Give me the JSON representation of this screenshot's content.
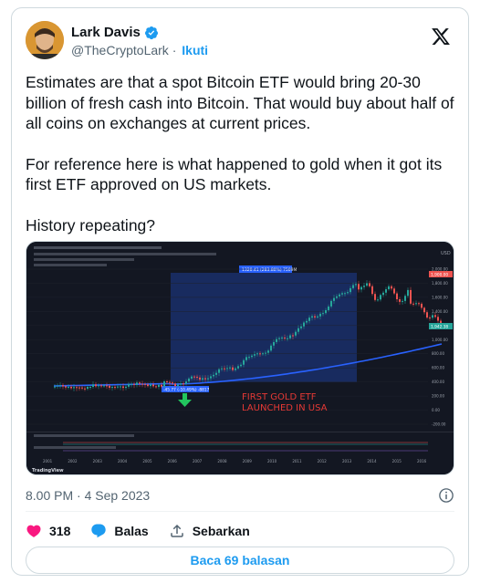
{
  "author": {
    "name": "Lark Davis",
    "handle": "@TheCryptoLark",
    "follow_label": "Ikuti"
  },
  "tweet": {
    "paragraphs": [
      "Estimates are that a spot Bitcoin ETF would bring 20-30 billion of fresh cash into Bitcoin. That would buy about half of all coins on exchanges at current prices.",
      "For reference here is what happened to gold when it got its first ETF approved on US markets.",
      "History repeating?"
    ],
    "timestamp": "8.00 PM · 4 Sep 2023"
  },
  "actions": {
    "likes": "318",
    "reply_label": "Balas",
    "share_label": "Sebarkan"
  },
  "read_replies_label": "Baca 69 balasan",
  "colors": {
    "accent": "#1d9bf0",
    "like": "#f91880",
    "chart_bg": "#131722",
    "candle_up": "#26a69a",
    "candle_down": "#ef5350",
    "ma_line": "#2962ff"
  },
  "media": {
    "annotation": "FIRST GOLD ETF LAUNCHED IN USA",
    "annotation_lines": [
      "FIRST GOLD ETF",
      "LAUNCHED IN USA"
    ],
    "price_label_top": "1,900.00",
    "price_label_current": "1,942.38",
    "price_label_ma": "924.86",
    "range_label": "1320.41 (283.80%) 7509M",
    "range_label_low": "-45.77 (-10.49%) -8817",
    "y_ticks": [
      "2,000.00",
      "1,800.00",
      "1,600.00",
      "1,400.00",
      "1,200.00",
      "1,000.00",
      "800.00",
      "600.00",
      "400.00",
      "200.00",
      "0.00",
      "-200.00"
    ],
    "x_ticks": [
      "2001",
      "2002",
      "2003",
      "2004",
      "2005",
      "2006",
      "2007",
      "2008",
      "2009",
      "2010",
      "2011",
      "2012",
      "2013",
      "2014",
      "2015",
      "2016"
    ],
    "currency": "USD",
    "watermark": "TradingView"
  }
}
